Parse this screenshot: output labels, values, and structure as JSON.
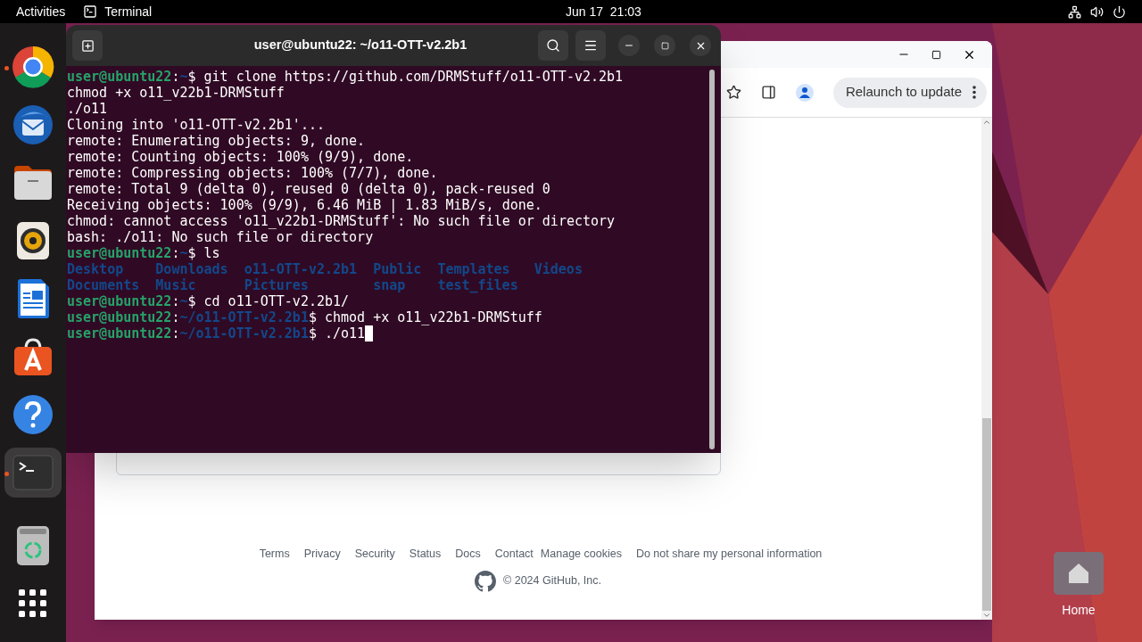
{
  "top_bar": {
    "activities": "Activities",
    "app_name": "Terminal",
    "clock": "Jun 17  21:03"
  },
  "dock": {
    "items": [
      {
        "kind": "chrome",
        "running": true,
        "selected": false
      },
      {
        "kind": "thunderbird",
        "running": false,
        "selected": false
      },
      {
        "kind": "files",
        "running": false,
        "selected": false
      },
      {
        "kind": "rhythmbox",
        "running": false,
        "selected": false
      },
      {
        "kind": "writer",
        "running": false,
        "selected": false
      },
      {
        "kind": "appcenter",
        "running": false,
        "selected": false
      },
      {
        "kind": "help",
        "running": false,
        "selected": false
      },
      {
        "kind": "terminal",
        "running": true,
        "selected": true
      },
      {
        "kind": "trash",
        "running": false,
        "selected": false
      },
      {
        "kind": "apps",
        "running": false,
        "selected": false
      }
    ]
  },
  "browser": {
    "relaunch": "Relaunch to update",
    "footer_links": [
      "Terms",
      "Privacy",
      "Security",
      "Status",
      "Docs",
      "Contact",
      "Manage cookies",
      "Do not share my personal information"
    ],
    "copyright": "© 2024 GitHub, Inc."
  },
  "terminal": {
    "title": "user@ubuntu22: ~/o11-OTT-v2.2b1",
    "lines": [
      {
        "kind": "prompt",
        "user": "user@ubuntu22",
        "colon": ":",
        "path": "~",
        "dollar": "$",
        "command": "git clone https://github.com/DRMStuff/o11-OTT-v2.2b1"
      },
      {
        "kind": "output",
        "text": "chmod +x o11_v22b1-DRMStuff"
      },
      {
        "kind": "output",
        "text": "./o11"
      },
      {
        "kind": "output",
        "text": "Cloning into 'o11-OTT-v2.2b1'..."
      },
      {
        "kind": "output",
        "text": "remote: Enumerating objects: 9, done."
      },
      {
        "kind": "output",
        "text": "remote: Counting objects: 100% (9/9), done."
      },
      {
        "kind": "output",
        "text": "remote: Compressing objects: 100% (7/7), done."
      },
      {
        "kind": "output",
        "text": "remote: Total 9 (delta 0), reused 0 (delta 0), pack-reused 0"
      },
      {
        "kind": "output",
        "text": "Receiving objects: 100% (9/9), 6.46 MiB | 1.83 MiB/s, done."
      },
      {
        "kind": "output",
        "text": "chmod: cannot access 'o11_v22b1-DRMStuff': No such file or directory"
      },
      {
        "kind": "output",
        "text": "bash: ./o11: No such file or directory"
      },
      {
        "kind": "prompt",
        "user": "user@ubuntu22",
        "colon": ":",
        "path": "~",
        "dollar": "$",
        "command": "ls"
      },
      {
        "kind": "listing",
        "entries": [
          "Desktop",
          "Downloads",
          "o11-OTT-v2.2b1",
          "Public",
          "Templates",
          "Videos"
        ]
      },
      {
        "kind": "listing",
        "entries": [
          "Documents",
          "Music",
          "Pictures",
          "snap",
          "test_files"
        ]
      },
      {
        "kind": "prompt",
        "user": "user@ubuntu22",
        "colon": ":",
        "path": "~",
        "dollar": "$",
        "command": "cd o11-OTT-v2.2b1/"
      },
      {
        "kind": "prompt",
        "user": "user@ubuntu22",
        "colon": ":",
        "path": "~/o11-OTT-v2.2b1",
        "dollar": "$",
        "command": "chmod +x o11_v22b1-DRMStuff"
      },
      {
        "kind": "prompt",
        "user": "user@ubuntu22",
        "colon": ":",
        "path": "~/o11-OTT-v2.2b1",
        "dollar": "$",
        "command": "./o11",
        "cursor": true
      }
    ]
  },
  "desktop": {
    "icons": [
      {
        "label": "Home"
      }
    ]
  }
}
